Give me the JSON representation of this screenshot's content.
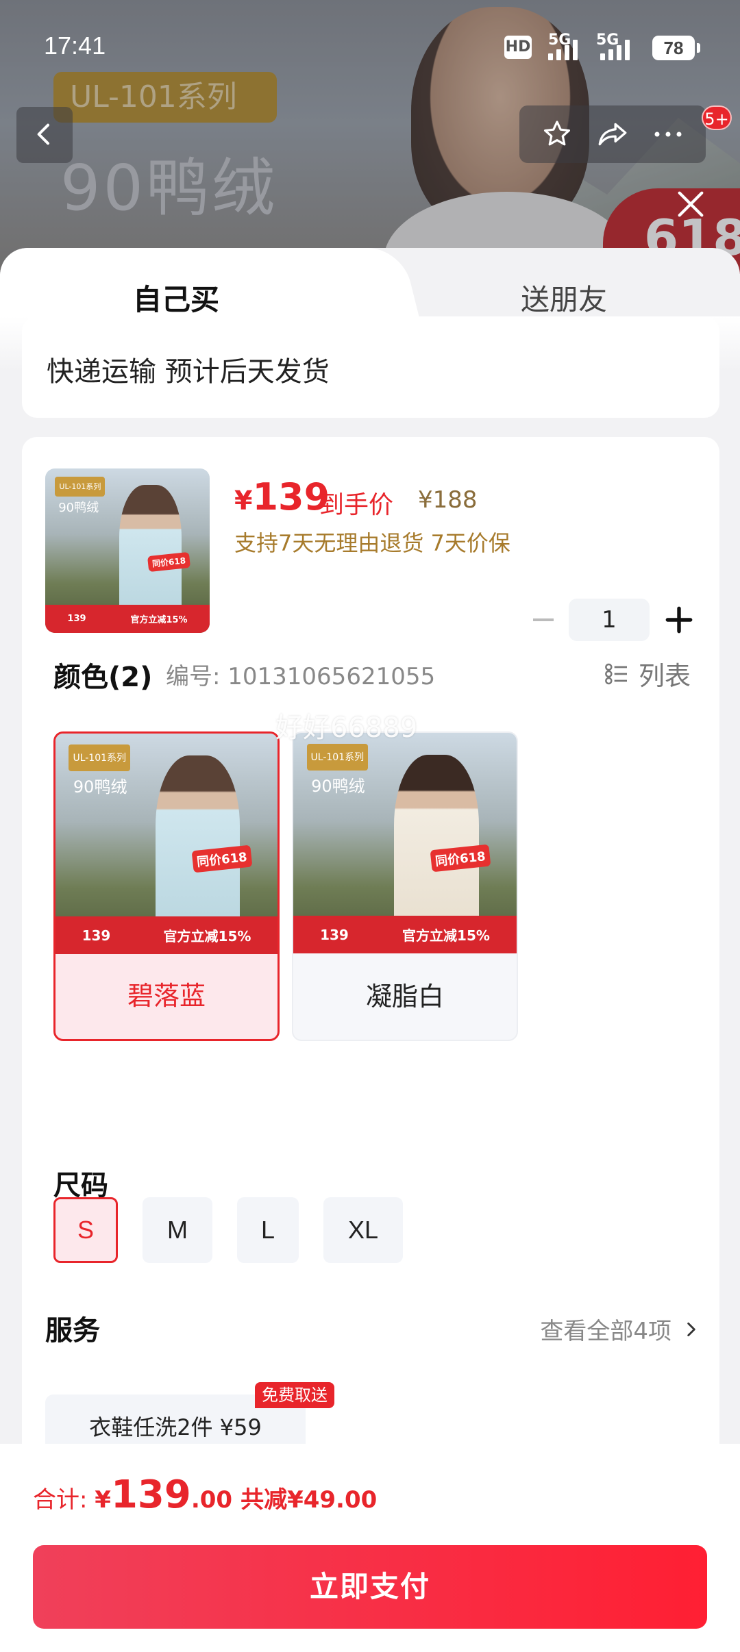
{
  "status_bar": {
    "time": "17:41",
    "hd_label": "HD",
    "sim1_label": "5G",
    "sim2_label": "5G",
    "battery": "78"
  },
  "hero": {
    "series_tag": "UL-101系列",
    "title": "90鸭绒",
    "promo_badge": "618",
    "notification_count": "5+"
  },
  "tabs": {
    "self": "自己买",
    "gift": "送朋友"
  },
  "shipping": {
    "text": "快递运输 预计后天发货"
  },
  "product": {
    "currency": "¥",
    "price": "139",
    "price_label": "到手价",
    "original_price": "¥188",
    "guarantee": "支持7天无理由退货 7天价保",
    "quantity": "1",
    "poster_tag": "UL-101系列",
    "poster_title": "90鸭绒",
    "poster_band_price": "139",
    "poster_band_promo": "官方立减15%",
    "poster_badge": "同价618"
  },
  "color": {
    "title": "颜色(2)",
    "sku_code": "编号: 10131065621055",
    "list_view_label": "列表",
    "watermark": "好好66889",
    "options": [
      {
        "label": "碧落蓝",
        "selected": true
      },
      {
        "label": "凝脂白",
        "selected": false
      }
    ]
  },
  "size": {
    "title": "尺码",
    "options": [
      "S",
      "M",
      "L",
      "XL"
    ],
    "selected": "S"
  },
  "service": {
    "title": "服务",
    "view_all": "查看全部4项",
    "chip_label": "衣鞋任洗2件 ¥59",
    "chip_badge": "免费取送"
  },
  "footer": {
    "total_label": "合计: ",
    "currency": "¥",
    "total_int": "139",
    "total_dec": ".00",
    "saving": "共减¥49.00",
    "pay_button": "立即支付"
  },
  "colors": {
    "accent": "#e8252b",
    "pay_gradient_start": "#f0405a",
    "pay_gradient_end": "#ff1f33",
    "guarantee_gold": "#a77b2c",
    "swatch_blue_coat": "#cfe6ee",
    "swatch_white_coat": "#f2ece1"
  }
}
